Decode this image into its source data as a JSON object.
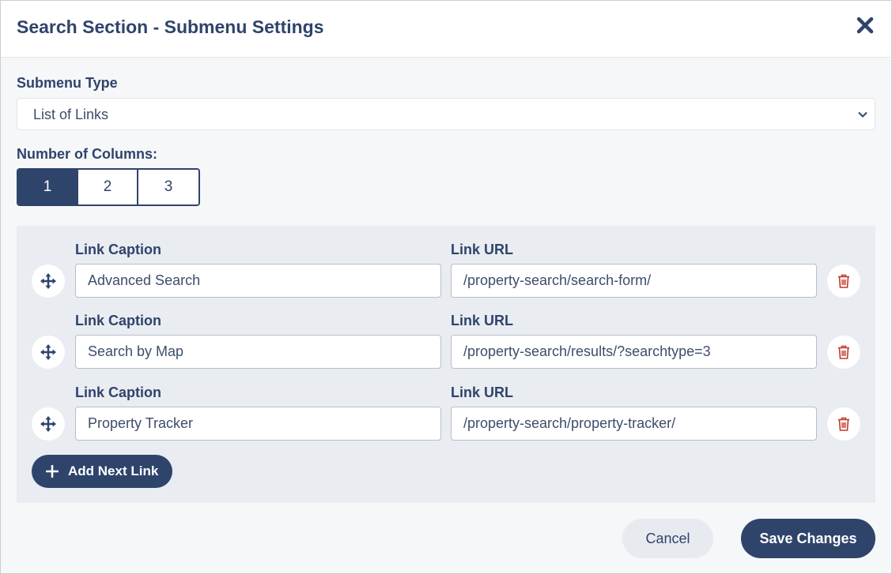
{
  "dialog": {
    "title": "Search Section - Submenu Settings",
    "close_icon": "close-icon"
  },
  "submenu_type": {
    "label": "Submenu Type",
    "value": "List of Links",
    "icon": "chevron-down-icon"
  },
  "columns": {
    "label": "Number of Columns:",
    "options": [
      "1",
      "2",
      "3"
    ],
    "selected": "1"
  },
  "links": {
    "caption_label": "Link Caption",
    "url_label": "Link URL",
    "items": [
      {
        "caption": "Advanced Search",
        "url": "/property-search/search-form/"
      },
      {
        "caption": "Search by Map",
        "url": "/property-search/results/?searchtype=3"
      },
      {
        "caption": "Property Tracker",
        "url": "/property-search/property-tracker/"
      }
    ],
    "add_label": "Add Next Link"
  },
  "footer": {
    "cancel_label": "Cancel",
    "save_label": "Save Changes"
  },
  "colors": {
    "primary": "#2f446b",
    "danger": "#c0392b",
    "panel": "#e9ecf1"
  }
}
